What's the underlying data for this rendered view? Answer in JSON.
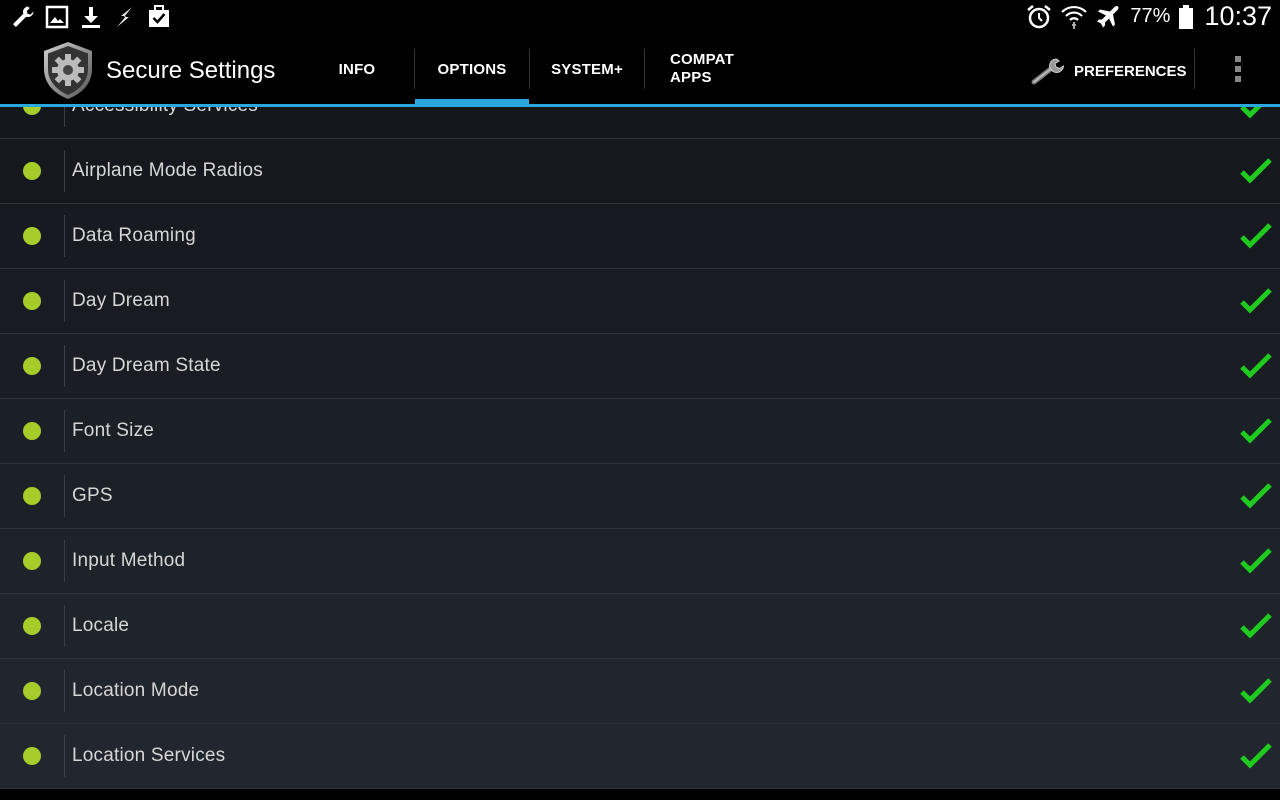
{
  "status_bar": {
    "left_icons": [
      "wrench-icon",
      "image-icon",
      "download-icon",
      "lightning-icon",
      "clipboard-check-icon"
    ],
    "right_icons": [
      "alarm-icon",
      "wifi-icon",
      "airplane-icon",
      "battery-icon"
    ],
    "battery_percent": "77%",
    "time": "10:37"
  },
  "action_bar": {
    "app_title": "Secure Settings",
    "tabs": [
      {
        "label": "INFO"
      },
      {
        "label": "OPTIONS"
      },
      {
        "label": "SYSTEM+"
      },
      {
        "label": "COMPAT\nAPPS"
      }
    ],
    "selected_tab": "OPTIONS",
    "preferences_label": "PREFERENCES",
    "accent_color": "#2aa7dc"
  },
  "list": {
    "status_color": "#a6cc2a",
    "check_color": "#1ecb1e",
    "items": [
      {
        "label": "Accessibility Services"
      },
      {
        "label": "Airplane Mode Radios"
      },
      {
        "label": "Data Roaming"
      },
      {
        "label": "Day Dream"
      },
      {
        "label": "Day Dream State"
      },
      {
        "label": "Font Size"
      },
      {
        "label": "GPS"
      },
      {
        "label": "Input Method"
      },
      {
        "label": "Locale"
      },
      {
        "label": "Location Mode"
      },
      {
        "label": "Location Services"
      }
    ]
  }
}
